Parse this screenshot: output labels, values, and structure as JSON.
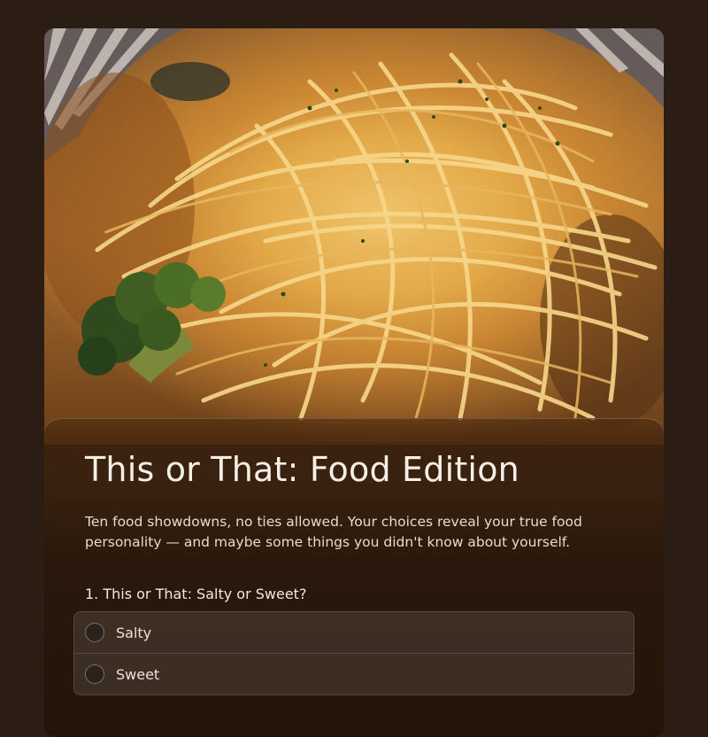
{
  "hero": {
    "image": "spaghetti-with-broccoli-photo"
  },
  "quiz": {
    "title": "This or That: Food Edition",
    "description": "Ten food showdowns, no ties allowed. Your choices reveal your true food personality — and maybe some things you didn't know about yourself.",
    "question": {
      "label": "1. This or That: Salty or Sweet?",
      "options": [
        {
          "label": "Salty",
          "selected": false
        },
        {
          "label": "Sweet",
          "selected": false
        }
      ]
    }
  }
}
